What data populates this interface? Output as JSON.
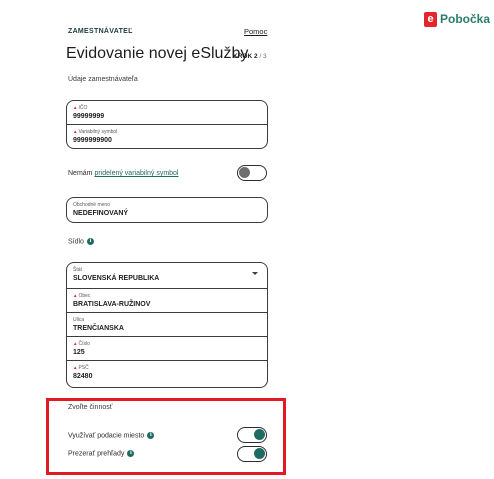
{
  "brand": {
    "logo_letter": "e",
    "logo_text": "Pobočka",
    "accent": "#2a7d6b",
    "mark_color": "#e4262c"
  },
  "header": {
    "section": "ZAMESTNÁVATEĽ",
    "help_link": "Pomoc",
    "title": "Evidovanie novej eSlužby",
    "step_label": "KROK 2",
    "step_total": "/ 3"
  },
  "employer": {
    "caption": "Údaje zamestnávateľa",
    "ico": {
      "label": "IČO",
      "value": "99999999"
    },
    "varsym": {
      "label": "Variabilný symbol",
      "value": "9999999900"
    }
  },
  "no_varsym": {
    "text_before": "Nemám ",
    "link_text": "pridelený variabilný symbol",
    "toggle": false
  },
  "business_name": {
    "label": "Obchodné meno",
    "value": "NEDEFINOVANÝ"
  },
  "seat": {
    "caption": "Sídlo",
    "info_icon": "info-icon",
    "state": {
      "label": "Štát",
      "value": "SLOVENSKÁ REPUBLIKA"
    },
    "city": {
      "label": "Obec",
      "value": "BRATISLAVA-RUŽINOV"
    },
    "street": {
      "label": "Ulica",
      "value": "TRENČIANSKA"
    },
    "number": {
      "label": "Číslo",
      "value": "125"
    },
    "zip": {
      "label": "PSČ",
      "value": "82480"
    }
  },
  "activity": {
    "caption": "Zvoľte činnosť",
    "items": [
      {
        "label": "Využívať podacie miesto",
        "enabled": true
      },
      {
        "label": "Prezerať prehľady",
        "enabled": true
      }
    ],
    "highlight_color": "#e01b24"
  }
}
